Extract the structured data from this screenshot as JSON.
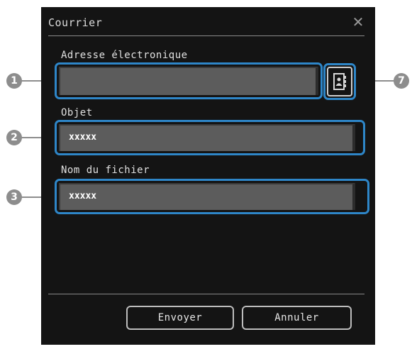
{
  "dialog": {
    "title": "Courrier",
    "close_icon": "close-icon"
  },
  "fields": [
    {
      "label": "Adresse électronique",
      "value": ""
    },
    {
      "label": "Objet",
      "value": "xxxxx"
    },
    {
      "label": "Nom du fichier",
      "value": "xxxxx"
    }
  ],
  "contacts_button": {
    "icon": "address-book-icon"
  },
  "buttons": {
    "send": "Envoyer",
    "cancel": "Annuler"
  },
  "callouts": [
    "1",
    "2",
    "3",
    "7"
  ],
  "colors": {
    "highlight": "#2e86c8",
    "background": "#141414",
    "field": "#5c5c5c",
    "callout": "#8d8d8d"
  }
}
